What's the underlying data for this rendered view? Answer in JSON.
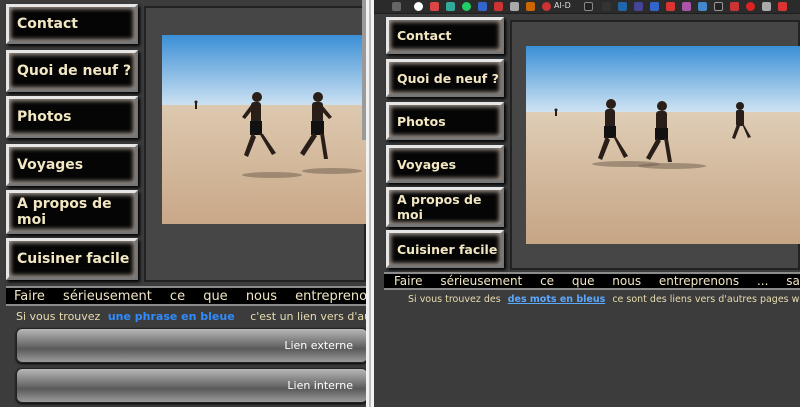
{
  "nav": {
    "items": [
      {
        "id": "contact",
        "label": "Contact"
      },
      {
        "id": "news",
        "label": "Quoi de neuf ?"
      },
      {
        "id": "photos",
        "label": "Photos"
      },
      {
        "id": "voyages",
        "label": "Voyages"
      },
      {
        "id": "about",
        "label": "A propos de moi"
      },
      {
        "id": "cuisine",
        "label": "Cuisiner facile"
      }
    ]
  },
  "ticker": {
    "left": "Faire sérieusement ce que nous entreprenons ...",
    "right": "Faire sérieusement ce que nous entreprenons ... sans se prendre"
  },
  "left_pane": {
    "sentence_prefix": "Si vous trouvez",
    "link_text": "une phrase en bleue",
    "sentence_suffix": "c'est un lien vers d'autres p",
    "buttons": {
      "external": "Lien externe",
      "internal": "Lien interne"
    }
  },
  "right_pane": {
    "sentence_prefix": "Si vous trouvez des",
    "link_text": "des mots en bleus",
    "sentence_suffix": "ce sont des liens vers d'autres pages web. I",
    "toolbar_extension_label": "Al-D"
  },
  "colors": {
    "link_blue": "#2f8cff",
    "nav_text": "#f2e7c2",
    "background": "#3c3c3c"
  },
  "photo": {
    "alt_icon": "beach-runners-photo"
  }
}
